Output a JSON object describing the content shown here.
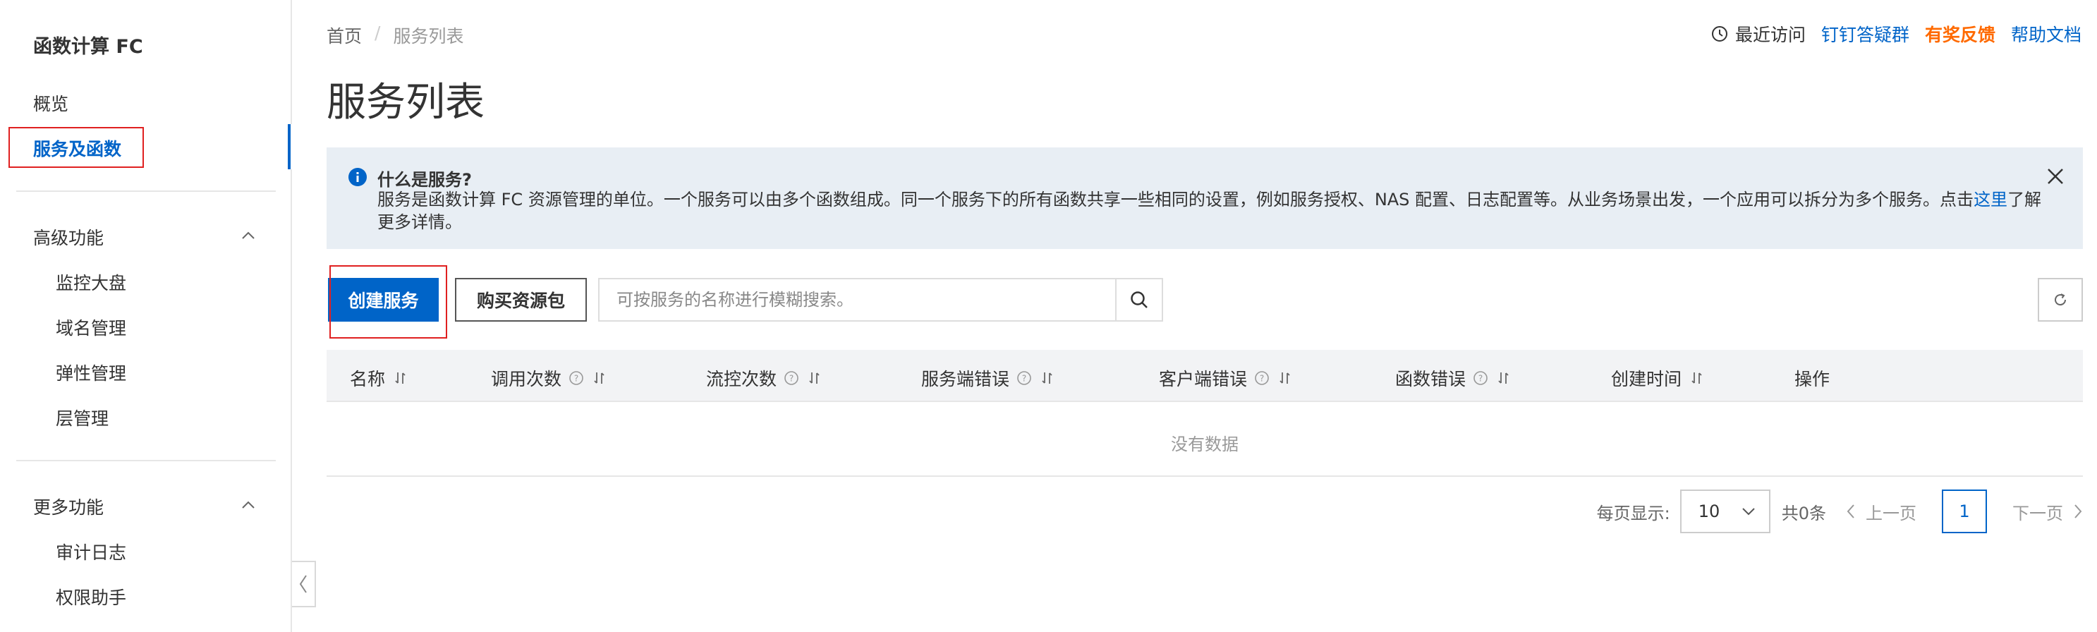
{
  "sidebar": {
    "title": "函数计算 FC",
    "items": [
      {
        "label": "概览"
      },
      {
        "label": "服务及函数"
      }
    ],
    "advanced": {
      "heading": "高级功能",
      "items": [
        {
          "label": "监控大盘"
        },
        {
          "label": "域名管理"
        },
        {
          "label": "弹性管理"
        },
        {
          "label": "层管理"
        }
      ]
    },
    "more": {
      "heading": "更多功能",
      "items": [
        {
          "label": "审计日志"
        },
        {
          "label": "权限助手"
        }
      ]
    }
  },
  "breadcrumb": {
    "home": "首页",
    "separator": "/",
    "current": "服务列表"
  },
  "page_title": "服务列表",
  "toplinks": {
    "recent": "最近访问",
    "dingtalk": "钉钉答疑群",
    "feedback": "有奖反馈",
    "help": "帮助文档"
  },
  "notice": {
    "title": "什么是服务?",
    "body_before": "服务是函数计算 FC 资源管理的单位。一个服务可以由多个函数组成。同一个服务下的所有函数共享一些相同的设置，例如服务授权、NAS 配置、日志配置等。从业务场景出发，一个应用可以拆分为多个服务。点击",
    "link": "这里",
    "body_after": "了解更多详情。"
  },
  "toolbar": {
    "create_label": "创建服务",
    "buy_label": "购买资源包",
    "search_placeholder": "可按服务的名称进行模糊搜索。",
    "search_value": ""
  },
  "table": {
    "columns": [
      {
        "label": "名称",
        "help": false
      },
      {
        "label": "调用次数",
        "help": true
      },
      {
        "label": "流控次数",
        "help": true
      },
      {
        "label": "服务端错误",
        "help": true
      },
      {
        "label": "客户端错误",
        "help": true
      },
      {
        "label": "函数错误",
        "help": true
      },
      {
        "label": "创建时间",
        "help": false
      },
      {
        "label": "操作",
        "help": false
      }
    ],
    "empty_text": "没有数据"
  },
  "pagination": {
    "per_page_label": "每页显示:",
    "per_page_value": "10",
    "total": "共0条",
    "prev": "上一页",
    "current_page": "1",
    "next": "下一页"
  },
  "colors": {
    "primary": "#0064c8",
    "highlight_box": "#e02020",
    "feedback": "#ff6a00",
    "notice_bg": "#e8eef4"
  }
}
